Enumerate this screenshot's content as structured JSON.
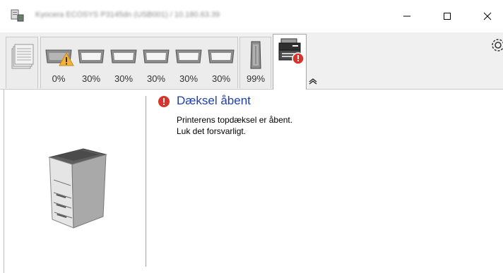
{
  "window": {
    "title": "Kyocera ECOSYS P3145dn (USB001) / 10.180.63.39",
    "minimize_symbol": "—",
    "maximize_symbol": "☐",
    "close_symbol": "✕"
  },
  "toolbar": {
    "supplies": [
      {
        "name": "paper-stack",
        "level": ""
      },
      {
        "name": "tray-warning",
        "level": "0%"
      },
      {
        "name": "tray-2",
        "level": "30%"
      },
      {
        "name": "tray-3",
        "level": "30%"
      },
      {
        "name": "tray-4",
        "level": "30%"
      },
      {
        "name": "tray-5",
        "level": "30%"
      },
      {
        "name": "tray-6",
        "level": "30%"
      },
      {
        "name": "toner",
        "level": "99%"
      }
    ],
    "active_tab": "printer-status",
    "collapse_symbol": "︽"
  },
  "status": {
    "title": "Dæksel åbent",
    "line1": "Printerens topdæksel er åbent.",
    "line2": "Luk det forsvarligt."
  },
  "colors": {
    "status_title": "#1f3fb0",
    "error": "#d9342b",
    "warning": "#f2b33d"
  }
}
